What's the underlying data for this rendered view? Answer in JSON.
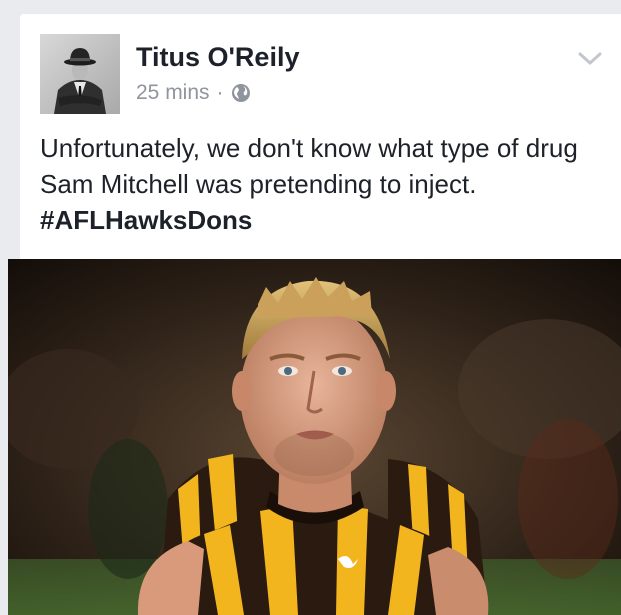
{
  "post": {
    "author": "Titus O'Reily",
    "time": "25 mins",
    "separator": "·",
    "privacy_icon": "globe-icon",
    "menu_icon": "chevron-down-icon",
    "text": "Unfortunately, we don't know what type of drug Sam Mitchell was pretending to inject.",
    "hashtag": "#AFLHawksDons"
  },
  "colors": {
    "background": "#e9ebee",
    "card": "#ffffff",
    "name_text": "#1d2129",
    "meta_text": "#90949c",
    "guernsey_gold": "#f2b51e",
    "guernsey_brown": "#2b1a10"
  }
}
